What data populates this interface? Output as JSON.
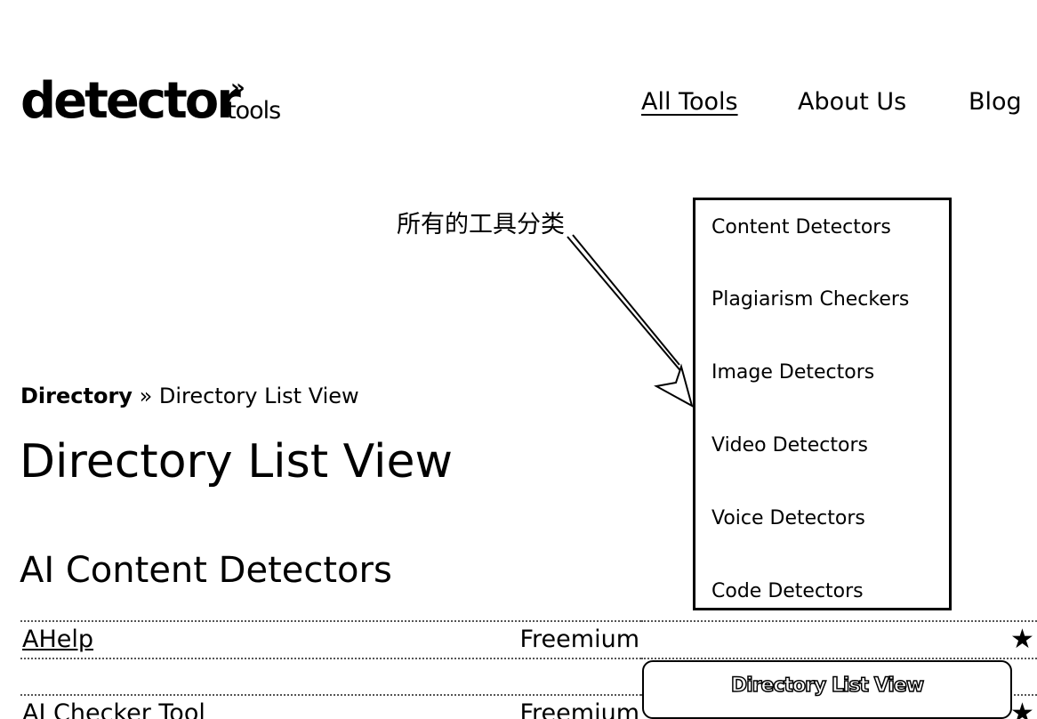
{
  "logo": {
    "main": "detector",
    "sub": "tools",
    "mark": "»"
  },
  "nav": {
    "items": [
      {
        "label": "All Tools",
        "active": true
      },
      {
        "label": "About Us",
        "active": false
      },
      {
        "label": "Blog",
        "active": false
      }
    ]
  },
  "annotation": {
    "label": "所有的工具分类"
  },
  "categories": [
    "Content Detectors",
    "Plagiarism Checkers",
    "Image Detectors",
    "Video Detectors",
    "Voice Detectors",
    "Code Detectors"
  ],
  "breadcrumb": {
    "root": "Directory",
    "separator": " » ",
    "current": "Directory List View"
  },
  "page_title": "Directory List View",
  "section_title": "AI Content Detectors",
  "tools": [
    {
      "name": "AHelp",
      "pricing": "Freemium",
      "icon": "star-icon"
    },
    {
      "name": "AI Checker Tool",
      "pricing": "Freemium",
      "icon": "star-icon"
    }
  ],
  "view_toggle": {
    "label": "Directory List View"
  }
}
